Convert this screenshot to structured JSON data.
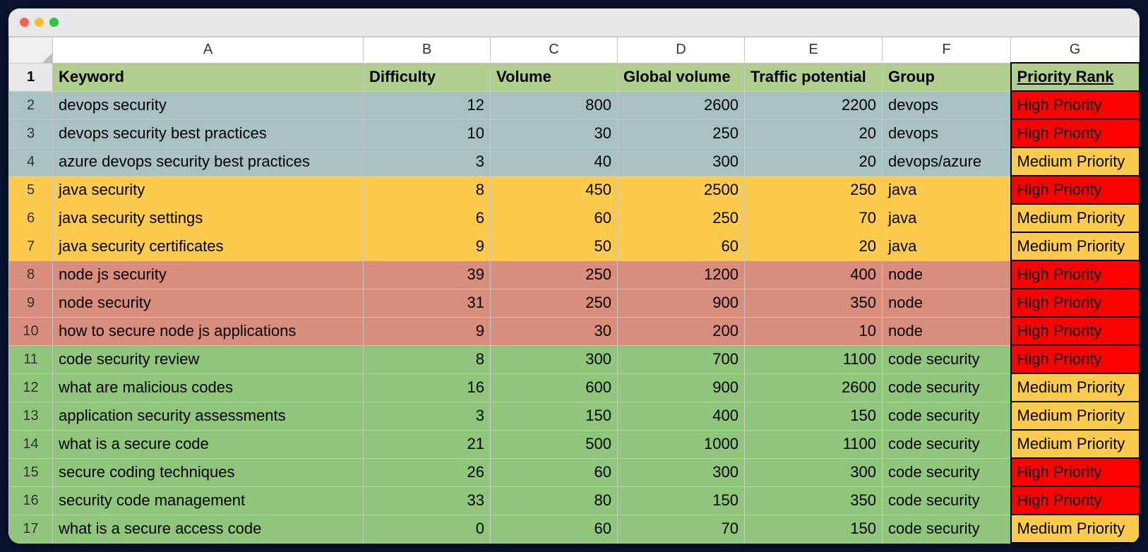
{
  "columns": [
    "A",
    "B",
    "C",
    "D",
    "E",
    "F",
    "G"
  ],
  "headers": {
    "keyword": "Keyword",
    "difficulty": "Difficulty",
    "volume": "Volume",
    "global_volume": "Global volume",
    "traffic_potential": "Traffic potential",
    "group": "Group",
    "priority_rank": "Priority Rank "
  },
  "rows": [
    {
      "n": 2,
      "group_color": "blue",
      "keyword": "devops security",
      "difficulty": 12,
      "volume": 800,
      "global_volume": 2600,
      "traffic_potential": 2200,
      "group": "devops",
      "priority": "High Priority"
    },
    {
      "n": 3,
      "group_color": "blue",
      "keyword": "devops security best practices",
      "difficulty": 10,
      "volume": 30,
      "global_volume": 250,
      "traffic_potential": 20,
      "group": "devops",
      "priority": "High Priority"
    },
    {
      "n": 4,
      "group_color": "blue",
      "keyword": "azure devops security best practices",
      "difficulty": 3,
      "volume": 40,
      "global_volume": 300,
      "traffic_potential": 20,
      "group": "devops/azure",
      "priority": "Medium Priority"
    },
    {
      "n": 5,
      "group_color": "yellow",
      "keyword": "java security",
      "difficulty": 8,
      "volume": 450,
      "global_volume": 2500,
      "traffic_potential": 250,
      "group": "java",
      "priority": "High Priority"
    },
    {
      "n": 6,
      "group_color": "yellow",
      "keyword": "java security settings",
      "difficulty": 6,
      "volume": 60,
      "global_volume": 250,
      "traffic_potential": 70,
      "group": "java",
      "priority": "Medium Priority"
    },
    {
      "n": 7,
      "group_color": "yellow",
      "keyword": "java security certificates",
      "difficulty": 9,
      "volume": 50,
      "global_volume": 60,
      "traffic_potential": 20,
      "group": "java",
      "priority": "Medium Priority"
    },
    {
      "n": 8,
      "group_color": "salmon",
      "keyword": "node js security",
      "difficulty": 39,
      "volume": 250,
      "global_volume": 1200,
      "traffic_potential": 400,
      "group": "node",
      "priority": "High Priority"
    },
    {
      "n": 9,
      "group_color": "salmon",
      "keyword": "node security",
      "difficulty": 31,
      "volume": 250,
      "global_volume": 900,
      "traffic_potential": 350,
      "group": "node",
      "priority": "High Priority"
    },
    {
      "n": 10,
      "group_color": "salmon",
      "keyword": "how to secure node js applications",
      "difficulty": 9,
      "volume": 30,
      "global_volume": 200,
      "traffic_potential": 10,
      "group": "node",
      "priority": "High Priority"
    },
    {
      "n": 11,
      "group_color": "green",
      "keyword": "code security review",
      "difficulty": 8,
      "volume": 300,
      "global_volume": 700,
      "traffic_potential": 1100,
      "group": "code security",
      "priority": "High Priority"
    },
    {
      "n": 12,
      "group_color": "green",
      "keyword": "what are malicious codes",
      "difficulty": 16,
      "volume": 600,
      "global_volume": 900,
      "traffic_potential": 2600,
      "group": "code security",
      "priority": "Medium Priority"
    },
    {
      "n": 13,
      "group_color": "green",
      "keyword": "application security assessments",
      "difficulty": 3,
      "volume": 150,
      "global_volume": 400,
      "traffic_potential": 150,
      "group": "code security",
      "priority": "Medium Priority"
    },
    {
      "n": 14,
      "group_color": "green",
      "keyword": "what is a secure code",
      "difficulty": 21,
      "volume": 500,
      "global_volume": 1000,
      "traffic_potential": 1100,
      "group": "code security",
      "priority": "Medium Priority"
    },
    {
      "n": 15,
      "group_color": "green",
      "keyword": "secure coding techniques",
      "difficulty": 26,
      "volume": 60,
      "global_volume": 300,
      "traffic_potential": 300,
      "group": "code security",
      "priority": "High Priority"
    },
    {
      "n": 16,
      "group_color": "green",
      "keyword": "security code management",
      "difficulty": 33,
      "volume": 80,
      "global_volume": 150,
      "traffic_potential": 350,
      "group": "code security",
      "priority": "High Priority"
    },
    {
      "n": 17,
      "group_color": "green",
      "keyword": "what is a secure access code",
      "difficulty": 0,
      "volume": 60,
      "global_volume": 70,
      "traffic_potential": 150,
      "group": "code security",
      "priority": "Medium Priority"
    }
  ]
}
